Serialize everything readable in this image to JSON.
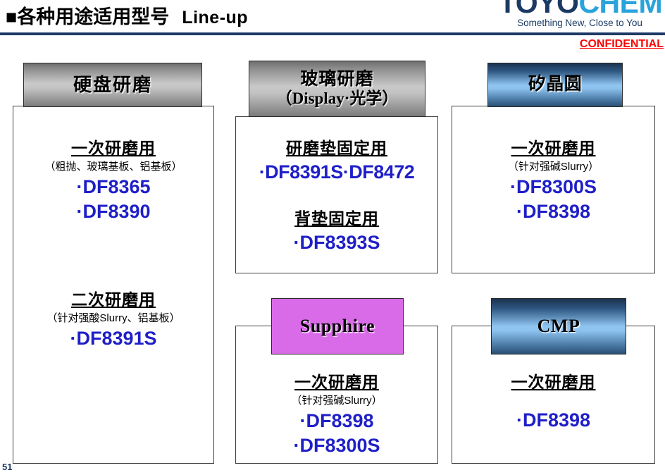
{
  "header": {
    "bullet": "■",
    "title_cn": "各种用途适用型号",
    "title_en": "Line-up",
    "logo_part1": "TOYO",
    "logo_part2": "CHEM",
    "logo_tagline": "Something New, Close to You",
    "confidential": "CONFIDENTIAL",
    "accent_rule_color": "#1f3864",
    "confidential_color": "#ff0000",
    "logo_color_1": "#1b3a63",
    "logo_color_2": "#29a3dc"
  },
  "page_number": "51",
  "cards": [
    {
      "id": "hdd-polishing",
      "plate_style": "gray",
      "plate_color": "#c2c2c2",
      "title": "硬盘研磨",
      "subtitle": "",
      "sections": [
        {
          "use": "一次研磨用",
          "note": "（粗抛、玻璃基板、铝基板）",
          "products": [
            "·DF8365",
            "·DF8390"
          ]
        },
        {
          "use": "二次研磨用",
          "note": "（针对强酸Slurry、铝基板）",
          "products": [
            "·DF8391S"
          ]
        }
      ]
    },
    {
      "id": "glass-polishing",
      "plate_style": "gray",
      "plate_color": "#c2c2c2",
      "title": "玻璃研磨",
      "subtitle": "（Display·光学）",
      "sections": [
        {
          "use": "研磨垫固定用",
          "note": "",
          "products": [
            "·DF8391S·DF8472"
          ]
        },
        {
          "use": "背垫固定用",
          "note": "",
          "products": [
            "·DF8393S"
          ]
        }
      ]
    },
    {
      "id": "silicon-wafer",
      "plate_style": "blue",
      "plate_color": "#8fc4f0",
      "title": "矽晶圆",
      "subtitle": "",
      "sections": [
        {
          "use": "一次研磨用",
          "note": "（针对强碱Slurry）",
          "products": [
            "·DF8300S",
            "·DF8398"
          ]
        }
      ]
    },
    {
      "id": "sapphire",
      "plate_style": "magenta",
      "plate_color": "#d96ae8",
      "title": "Supphire",
      "subtitle": "",
      "sections": [
        {
          "use": "一次研磨用",
          "note": "（针对强碱Slurry）",
          "products": [
            "·DF8398",
            "·DF8300S"
          ]
        }
      ]
    },
    {
      "id": "cmp",
      "plate_style": "blue",
      "plate_color": "#8fc4f0",
      "title": "CMP",
      "subtitle": "",
      "sections": [
        {
          "use": "一次研磨用",
          "note": "",
          "products": [
            "·DF8398"
          ]
        }
      ]
    }
  ]
}
